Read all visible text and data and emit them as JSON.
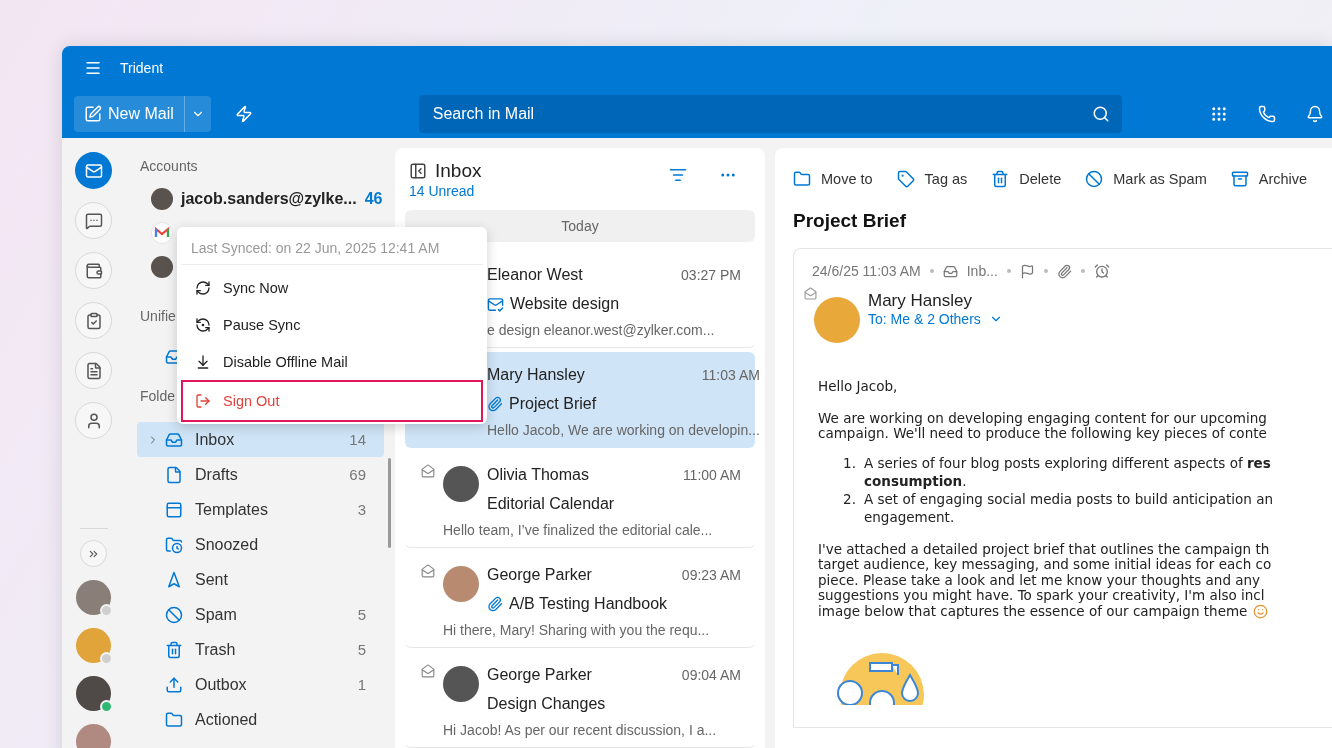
{
  "window": {
    "title": "Trident"
  },
  "toolbar": {
    "new_mail": "New Mail",
    "search": {
      "placeholder": "Search in Mail"
    }
  },
  "rail": {
    "items": [
      {
        "kind": "mail",
        "selected": true
      },
      {
        "kind": "chat",
        "selected": false
      },
      {
        "kind": "wallet",
        "selected": false
      },
      {
        "kind": "tasks",
        "selected": false
      },
      {
        "kind": "notes",
        "selected": false
      },
      {
        "kind": "contacts",
        "selected": false
      }
    ],
    "people": [
      {
        "kind": "avatar",
        "color": "#cfcfcf"
      },
      {
        "kind": "avatar",
        "color": "#cfcfcf"
      },
      {
        "kind": "avatar",
        "color": "#2eb872"
      },
      {
        "kind": "avatar"
      }
    ]
  },
  "accounts": {
    "heading": "Accounts",
    "items": [
      {
        "kind": "avatar",
        "name": "jacob.sanders@zylke...",
        "count": "46"
      },
      {
        "kind": "gmail"
      },
      {
        "kind": "avatar"
      }
    ]
  },
  "unified": {
    "heading": "Unifie",
    "items": [
      {
        "kind": "inbox"
      }
    ]
  },
  "folders": {
    "heading": "Folde",
    "items": [
      {
        "kind": "inbox",
        "label": "Inbox",
        "count": "14",
        "selected": true
      },
      {
        "kind": "drafts",
        "label": "Drafts",
        "count": "69",
        "selected": false
      },
      {
        "kind": "templates",
        "label": "Templates",
        "count": "3",
        "selected": false
      },
      {
        "kind": "snoozed",
        "label": "Snoozed",
        "selected": false
      },
      {
        "kind": "sent",
        "label": "Sent",
        "selected": false
      },
      {
        "kind": "spam",
        "label": "Spam",
        "count": "5",
        "selected": false
      },
      {
        "kind": "trash",
        "label": "Trash",
        "count": "5",
        "selected": false
      },
      {
        "kind": "outbox",
        "label": "Outbox",
        "count": "1",
        "selected": false
      },
      {
        "kind": "folder",
        "label": "Actioned",
        "selected": false
      }
    ]
  },
  "menu": {
    "header": "Last Synced:  on 22 Jun, 2025 12:41 AM",
    "items": [
      {
        "kind": "sync",
        "label": "Sync Now",
        "highlighted": false
      },
      {
        "kind": "pause",
        "label": "Pause Sync",
        "highlighted": false
      },
      {
        "kind": "offline",
        "label": "Disable Offline Mail",
        "highlighted": false
      },
      {
        "kind": "signout",
        "label": "Sign Out",
        "highlighted": true
      }
    ]
  },
  "mail_list": {
    "title": "Inbox",
    "unread": "14 Unread",
    "group": "Today",
    "items": [
      {
        "sender": "Eleanor West",
        "time": "03:27 PM",
        "subject": "Website design",
        "secure": true,
        "attachment": false,
        "preview": "e design eleanor.west@zylker.com...",
        "avatar": false,
        "selected": false
      },
      {
        "sender": "Mary Hansley",
        "time": "11:03 AM",
        "subject": "Project Brief",
        "secure": false,
        "attachment": true,
        "preview": "Hello Jacob, We are working on developin...",
        "avatar": false,
        "selected": true
      },
      {
        "sender": "Olivia Thomas",
        "time": "11:00 AM",
        "subject": "Editorial Calendar",
        "secure": false,
        "attachment": false,
        "preview": "Hello team, I’ve finalized the editorial cale...",
        "avatar": true,
        "selected": false
      },
      {
        "sender": "George Parker",
        "time": "09:23 AM",
        "subject": "A/B Testing Handbook",
        "secure": false,
        "attachment": true,
        "preview": "Hi there, Mary! Sharing with you the requ...",
        "avatar": true,
        "selected": false
      },
      {
        "sender": "George Parker",
        "time": "09:04 AM",
        "subject": "Design Changes",
        "secure": false,
        "attachment": false,
        "preview": "Hi Jacob! As per our recent discussion, I a...",
        "avatar": true,
        "selected": false
      }
    ]
  },
  "reading": {
    "actions": [
      {
        "kind": "move",
        "label": "Move to"
      },
      {
        "kind": "tag",
        "label": "Tag as"
      },
      {
        "kind": "delete",
        "label": "Delete"
      },
      {
        "kind": "spam",
        "label": "Mark as Spam"
      },
      {
        "kind": "archive",
        "label": "Archive"
      }
    ],
    "subject": "Project Brief",
    "date": "24/6/25 11:03 AM",
    "folder": "Inb...",
    "sender": "Mary Hansley",
    "to": "To: Me & 2 Others",
    "body": [
      {
        "kind": "p",
        "lines": [
          "Hello Jacob,"
        ]
      },
      {
        "kind": "p",
        "lines": [
          "We are working on developing engaging content for our upcoming",
          "campaign. We'll need to produce the following key pieces of conte"
        ]
      },
      {
        "kind": "ol",
        "items": [
          {
            "number": "1.",
            "lines": [
              "A series of four blog posts exploring different aspects of **res**",
              "**consumption**."
            ]
          },
          {
            "number": "2.",
            "lines": [
              "A set of engaging social media posts to build anticipation an",
              "engagement."
            ]
          }
        ]
      },
      {
        "kind": "p",
        "lines": [
          "I've attached a detailed project brief that outlines the campaign th",
          "target audience, key messaging, and some initial ideas for each co",
          "piece. Please take a look and let me know your thoughts and any",
          "suggestions you might have. To spark your creativity, I'm also incl",
          "image below that captures the essence of our campaign theme"
        ],
        "emoji": true
      }
    ]
  }
}
